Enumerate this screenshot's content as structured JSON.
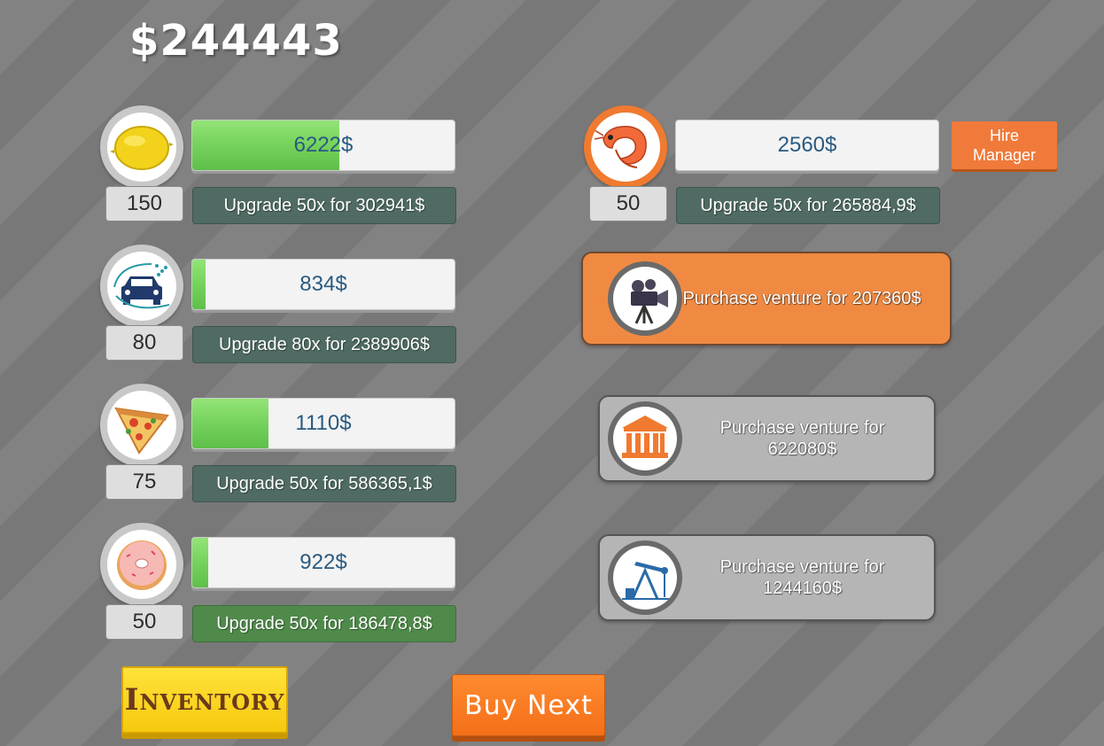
{
  "money": "$244443",
  "businesses": [
    {
      "icon": "lemon-icon",
      "progress": 0.56,
      "value": "6222$",
      "count": "150",
      "upgrade": "Upgrade 50x for 302941$",
      "upgrade_affordable": false
    },
    {
      "icon": "car-wash-icon",
      "progress": 0.05,
      "value": "834$",
      "count": "80",
      "upgrade": "Upgrade 80x for 2389906$",
      "upgrade_affordable": false
    },
    {
      "icon": "pizza-icon",
      "progress": 0.29,
      "value": "1110$",
      "count": "75",
      "upgrade": "Upgrade 50x for 586365,1$",
      "upgrade_affordable": false
    },
    {
      "icon": "donut-icon",
      "progress": 0.06,
      "value": "922$",
      "count": "50",
      "upgrade": "Upgrade 50x for 186478,8$",
      "upgrade_affordable": true
    },
    {
      "icon": "shrimp-icon",
      "progress": 0.0,
      "value": "2560$",
      "count": "50",
      "upgrade": "Upgrade 50x for 265884,9$",
      "upgrade_affordable": false
    }
  ],
  "hire_manager": "Hire\nManager",
  "ventures": [
    {
      "icon": "movie-camera-icon",
      "text": "Purchase venture for 207360$",
      "affordable": true
    },
    {
      "icon": "bank-icon",
      "text": "Purchase venture for 622080$",
      "affordable": false
    },
    {
      "icon": "oil-pump-icon",
      "text": "Purchase venture for 1244160$",
      "affordable": false
    }
  ],
  "inventory_label": "Inventory",
  "buy_next_label": "Buy Next",
  "colors": {
    "accent_orange": "#f07a3a",
    "progress_green": "#77d45e",
    "upgrade_dark": "#4f6b63",
    "upgrade_green": "#4f8a4a",
    "inventory_yellow": "#f6c90e"
  }
}
